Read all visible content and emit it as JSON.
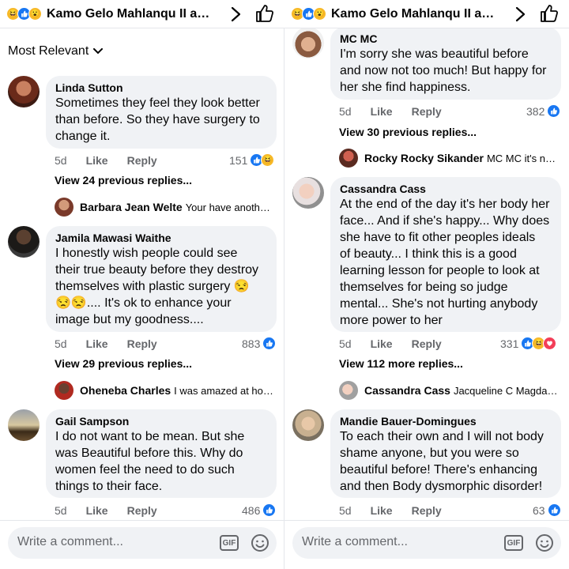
{
  "header": {
    "title": "Kamo Gelo Mahlanqu II and ..."
  },
  "icons": {
    "reactions": [
      "haha-icon",
      "like-icon",
      "wow-icon"
    ],
    "chevron": "chevron-right-icon",
    "like_page": "thumbs-up-icon",
    "gif": "gif-icon",
    "emoji": "smiley-icon"
  },
  "colors": {
    "bubble": "#f0f2f5",
    "like_blue": "#1877f2",
    "haha_yellow": "#f7b928",
    "love_red": "#f33e58",
    "meta_gray": "#65676b"
  },
  "actions": {
    "like": "Like",
    "reply": "Reply"
  },
  "footer": {
    "placeholder": "Write a comment...",
    "gif_label": "GIF"
  },
  "left": {
    "sort_label": "Most Relevant",
    "comments": [
      {
        "author": "Linda Sutton",
        "text": "Sometimes they feel they look better\nthan before. So they have surgery to\nchange it.",
        "time": "5d",
        "count": "151",
        "view_more": "View 24 previous replies...",
        "reply_author": "Barbara Jean Welte",
        "reply_text": "Your have another..."
      },
      {
        "author": "Jamila Mawasi Waithe",
        "text": "I honestly wish people could see\ntheir true beauty before they destroy\nthemselves with plastic surgery 😒\n😒😒.... It's ok to enhance your\nimage but my goodness....",
        "time": "5d",
        "count": "883",
        "view_more": "View 29 previous replies...",
        "reply_author": "Oheneba Charles",
        "reply_text": "I was amazed at how..."
      },
      {
        "author": "Gail Sampson",
        "text": "I do not want to be mean. But she\nwas Beautiful before this. Why do\nwomen feel the need to do such\nthings to their face.",
        "time": "5d",
        "count": "486"
      }
    ]
  },
  "right": {
    "comments": [
      {
        "author": "MC MC",
        "text": "I'm sorry she was beautiful before\nand now not too much! But happy for\nher she find happiness.",
        "time": "5d",
        "count": "382",
        "view_more": "View 30 previous replies...",
        "reply_author": "Rocky Rocky Sikander",
        "reply_text": "MC MC it's not..."
      },
      {
        "author": "Cassandra Cass",
        "text": "At the end of the day it's her body her\nface... And if she's happy... Why does\nshe have to fit other peoples ideals\nof beauty... I think this is a good\nlearning lesson for people to look at\nthemselves for being so judge\nmental... She's not hurting anybody\nmore power to her",
        "time": "5d",
        "count": "331",
        "view_more": "View 112 more replies...",
        "reply_author": "Cassandra Cass",
        "reply_text": "Jacqueline C Magdara..."
      },
      {
        "author": "Mandie Bauer-Domingues",
        "text": "To each their own and I will not body\nshame anyone, but you were so\nbeautiful before! There's enhancing\nand then  Body dysmorphic disorder!",
        "time": "5d",
        "count": "63"
      }
    ]
  }
}
